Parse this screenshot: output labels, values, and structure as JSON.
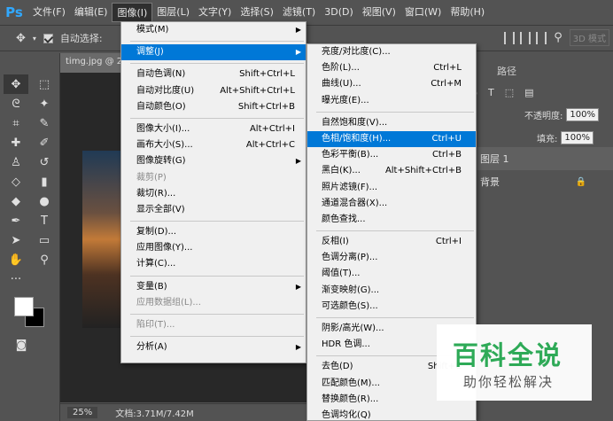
{
  "menubar": {
    "logo": "Ps",
    "items": [
      "文件(F)",
      "编辑(E)",
      "图像(I)",
      "图层(L)",
      "文字(Y)",
      "选择(S)",
      "滤镜(T)",
      "3D(D)",
      "视图(V)",
      "窗口(W)",
      "帮助(H)"
    ],
    "active_index": 2
  },
  "options_bar": {
    "move_icon": "move-icon",
    "auto_select_label": "自动选择:",
    "mode_3d": "3D 模式"
  },
  "document": {
    "tab_title": "timg.jpg @ 2",
    "zoom": "25%",
    "doc_info": "文档:3.71M/7.42M"
  },
  "image_menu": {
    "items": [
      {
        "label": "模式(M)",
        "shortcut": "",
        "submenu": true
      },
      {
        "sep": true
      },
      {
        "label": "调整(J)",
        "shortcut": "",
        "submenu": true,
        "highlight": true
      },
      {
        "sep": true
      },
      {
        "label": "自动色调(N)",
        "shortcut": "Shift+Ctrl+L"
      },
      {
        "label": "自动对比度(U)",
        "shortcut": "Alt+Shift+Ctrl+L"
      },
      {
        "label": "自动颜色(O)",
        "shortcut": "Shift+Ctrl+B"
      },
      {
        "sep": true
      },
      {
        "label": "图像大小(I)...",
        "shortcut": "Alt+Ctrl+I"
      },
      {
        "label": "画布大小(S)...",
        "shortcut": "Alt+Ctrl+C"
      },
      {
        "label": "图像旋转(G)",
        "shortcut": "",
        "submenu": true
      },
      {
        "label": "裁剪(P)",
        "shortcut": "",
        "disabled": true
      },
      {
        "label": "裁切(R)...",
        "shortcut": ""
      },
      {
        "label": "显示全部(V)",
        "shortcut": ""
      },
      {
        "sep": true
      },
      {
        "label": "复制(D)...",
        "shortcut": ""
      },
      {
        "label": "应用图像(Y)...",
        "shortcut": ""
      },
      {
        "label": "计算(C)...",
        "shortcut": ""
      },
      {
        "sep": true
      },
      {
        "label": "变量(B)",
        "shortcut": "",
        "submenu": true
      },
      {
        "label": "应用数据组(L)...",
        "shortcut": "",
        "disabled": true
      },
      {
        "sep": true
      },
      {
        "label": "陷印(T)...",
        "shortcut": "",
        "disabled": true
      },
      {
        "sep": true
      },
      {
        "label": "分析(A)",
        "shortcut": "",
        "submenu": true
      }
    ]
  },
  "adjust_submenu": {
    "items": [
      {
        "label": "亮度/对比度(C)...",
        "shortcut": ""
      },
      {
        "label": "色阶(L)...",
        "shortcut": "Ctrl+L"
      },
      {
        "label": "曲线(U)...",
        "shortcut": "Ctrl+M"
      },
      {
        "label": "曝光度(E)...",
        "shortcut": ""
      },
      {
        "sep": true
      },
      {
        "label": "自然饱和度(V)...",
        "shortcut": ""
      },
      {
        "label": "色相/饱和度(H)...",
        "shortcut": "Ctrl+U",
        "highlight": true
      },
      {
        "label": "色彩平衡(B)...",
        "shortcut": "Ctrl+B"
      },
      {
        "label": "黑白(K)...",
        "shortcut": "Alt+Shift+Ctrl+B"
      },
      {
        "label": "照片滤镜(F)...",
        "shortcut": ""
      },
      {
        "label": "通道混合器(X)...",
        "shortcut": ""
      },
      {
        "label": "颜色查找...",
        "shortcut": ""
      },
      {
        "sep": true
      },
      {
        "label": "反相(I)",
        "shortcut": "Ctrl+I"
      },
      {
        "label": "色调分离(P)...",
        "shortcut": ""
      },
      {
        "label": "阈值(T)...",
        "shortcut": ""
      },
      {
        "label": "渐变映射(G)...",
        "shortcut": ""
      },
      {
        "label": "可选颜色(S)...",
        "shortcut": ""
      },
      {
        "sep": true
      },
      {
        "label": "阴影/高光(W)...",
        "shortcut": ""
      },
      {
        "label": "HDR 色调...",
        "shortcut": ""
      },
      {
        "sep": true
      },
      {
        "label": "去色(D)",
        "shortcut": "Shift+C"
      },
      {
        "label": "匹配颜色(M)...",
        "shortcut": ""
      },
      {
        "label": "替换颜色(R)...",
        "shortcut": ""
      },
      {
        "label": "色调均化(Q)",
        "shortcut": ""
      }
    ]
  },
  "right_panel": {
    "tab_paths": "路径",
    "opacity_label": "不透明度:",
    "opacity_value": "100%",
    "fill_label": "填充:",
    "fill_value": "100%",
    "layers": [
      "图层 1",
      "背景"
    ]
  },
  "watermark": {
    "title": "百科全说",
    "subtitle": "助你轻松解决"
  }
}
